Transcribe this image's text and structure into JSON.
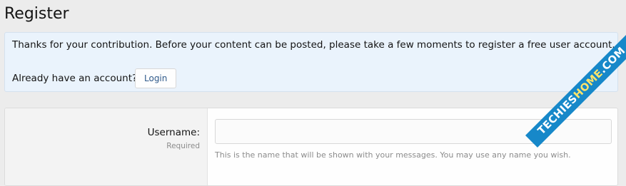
{
  "page": {
    "title": "Register"
  },
  "notice": {
    "message": "Thanks for your contribution. Before your content can be posted, please take a few moments to register a free user account.",
    "already_text": "Already have an account?",
    "login_label": "Login"
  },
  "form": {
    "username": {
      "label": "Username:",
      "required": "Required",
      "value": "",
      "hint": "This is the name that will be shown with your messages. You may use any name you wish."
    }
  },
  "watermark": {
    "part1": "TECHIES",
    "part2": "HOME",
    "part3": ".COM"
  },
  "colors": {
    "notice_background": "#eaf3fc",
    "link": "#2f5a8a",
    "watermark_background": "#1788c9",
    "watermark_accent": "#ffe46a"
  }
}
